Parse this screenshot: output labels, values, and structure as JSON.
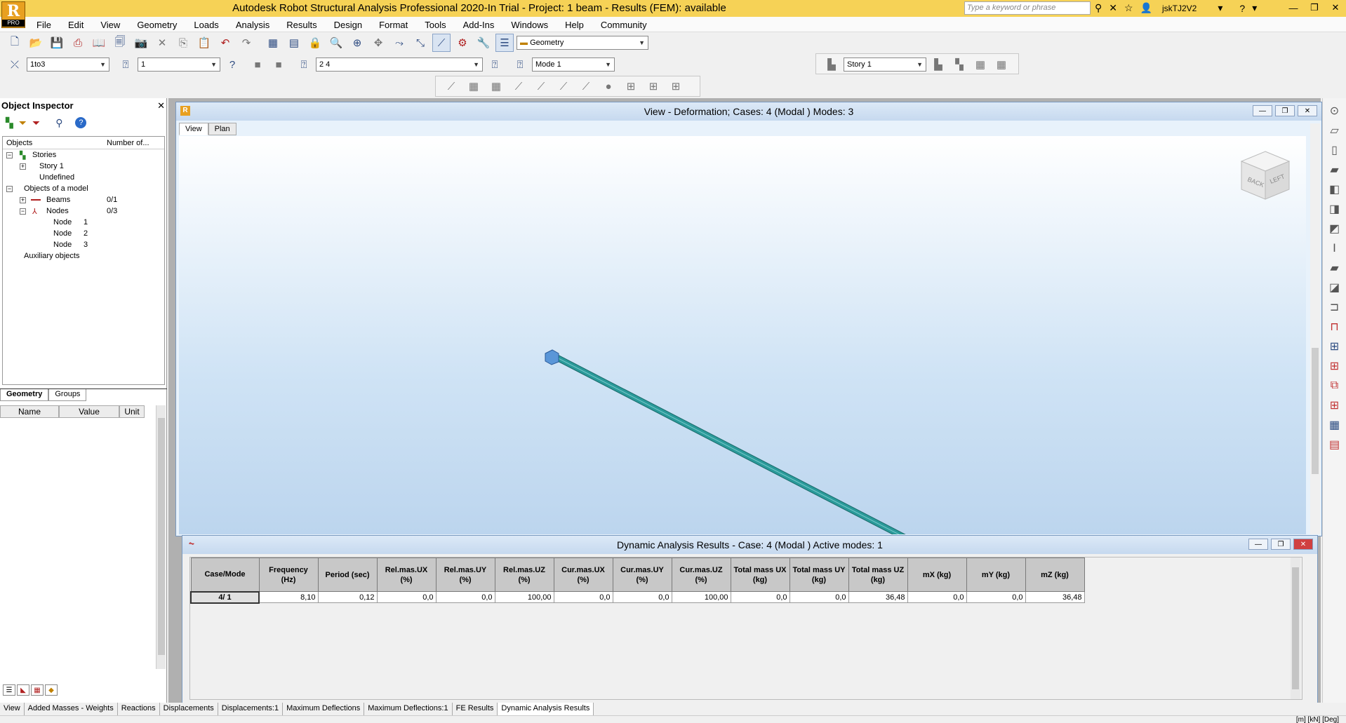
{
  "app": {
    "title": "Autodesk Robot Structural Analysis Professional 2020-In Trial - Project: 1 beam - Results (FEM): available",
    "logo_letter": "R",
    "logo_badge": "PRO",
    "search_placeholder": "Type a keyword or phrase",
    "user": "jskTJ2V2"
  },
  "menu": [
    "File",
    "Edit",
    "View",
    "Geometry",
    "Loads",
    "Analysis",
    "Results",
    "Design",
    "Format",
    "Tools",
    "Add-Ins",
    "Windows",
    "Help",
    "Community"
  ],
  "toolbar": {
    "layout_combo": "Geometry",
    "selection_combo": "1to3",
    "case_combo": "1",
    "cases_list_combo": "2 4",
    "mode_combo": "Mode  1",
    "story_combo": "Story 1"
  },
  "object_inspector": {
    "title": "Object Inspector",
    "col_objects": "Objects",
    "col_number": "Number of...",
    "tree": {
      "stories": "Stories",
      "story1": "Story 1",
      "undefined": "Undefined",
      "objects_model": "Objects of a model",
      "beams": "Beams",
      "beams_count": "0/1",
      "nodes": "Nodes",
      "nodes_count": "0/3",
      "node_label": "Node",
      "node1": "1",
      "node2": "2",
      "node3": "3",
      "auxiliary": "Auxiliary objects"
    },
    "tab_geometry": "Geometry",
    "tab_groups": "Groups",
    "prop_name": "Name",
    "prop_value": "Value",
    "prop_unit": "Unit"
  },
  "view_window": {
    "title": "View - Deformation; Cases: 4 (Modal ) Modes: 3",
    "tab_view": "View",
    "tab_plan": "Plan",
    "navcube_back": "BACK",
    "navcube_left": "LEFT"
  },
  "results_window": {
    "title": "Dynamic Analysis Results - Case: 4 (Modal ) Active modes: 1",
    "headers": [
      [
        "Case/Mode",
        ""
      ],
      [
        "Frequency",
        "(Hz)"
      ],
      [
        "Period (sec)",
        ""
      ],
      [
        "Rel.mas.UX",
        "(%)"
      ],
      [
        "Rel.mas.UY",
        "(%)"
      ],
      [
        "Rel.mas.UZ",
        "(%)"
      ],
      [
        "Cur.mas.UX",
        "(%)"
      ],
      [
        "Cur.mas.UY",
        "(%)"
      ],
      [
        "Cur.mas.UZ",
        "(%)"
      ],
      [
        "Total mass UX",
        "(kg)"
      ],
      [
        "Total mass UY",
        "(kg)"
      ],
      [
        "Total mass UZ",
        "(kg)"
      ],
      [
        "mX (kg)",
        ""
      ],
      [
        "mY (kg)",
        ""
      ],
      [
        "mZ (kg)",
        ""
      ]
    ],
    "row": {
      "case_mode": "4/      1",
      "values": [
        "8,10",
        "0,12",
        "0,0",
        "0,0",
        "100,00",
        "0,0",
        "0,0",
        "100,00",
        "0,0",
        "0,0",
        "36,48",
        "0,0",
        "0,0",
        "36,48"
      ]
    }
  },
  "bottom_tabs": [
    "View",
    "Added Masses - Weights",
    "Reactions",
    "Displacements",
    "Displacements:1",
    "Maximum Deflections",
    "Maximum Deflections:1",
    "FE Results",
    "Dynamic Analysis Results"
  ],
  "status": {
    "units": "[m] [kN] [Deg]"
  },
  "colors": {
    "titlebar": "#f6d256",
    "beam": "#2a9a9a",
    "node": "#4a86c8"
  }
}
